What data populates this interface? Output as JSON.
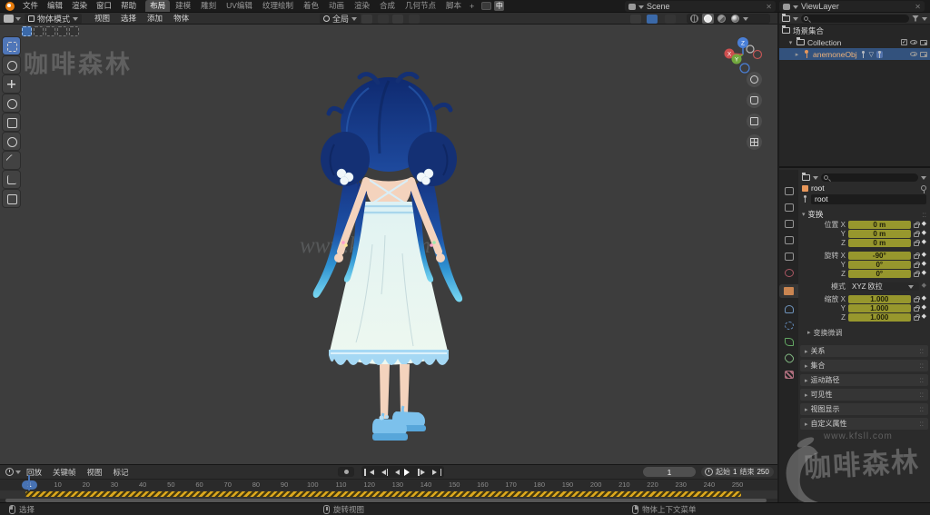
{
  "topbar": {
    "menus": [
      "文件",
      "编辑",
      "渲染",
      "窗口",
      "帮助"
    ],
    "workspaces": [
      {
        "label": "布局",
        "active": true
      },
      "建模",
      "雕刻",
      "UV编辑",
      "纹理绘制",
      "着色",
      "动画",
      "渲染",
      "合成",
      "几何节点",
      "脚本"
    ],
    "add_tab": "+",
    "ime_badge": "中",
    "scene_name": "Scene",
    "view_layer_name": "ViewLayer"
  },
  "viewport_header": {
    "mode": "物体模式",
    "menus": [
      "视图",
      "选择",
      "添加",
      "物体"
    ],
    "orientation": "全局"
  },
  "viewport": {
    "gizmo_axes": {
      "x": "X",
      "y": "Y",
      "z": "Z"
    },
    "watermark_brand": "咖啡森林",
    "watermark_url": "www.kfsll.com"
  },
  "outliner": {
    "scene_collection": "场景集合",
    "collection": "Collection",
    "object_name": "anemoneObj"
  },
  "properties": {
    "tabs": [
      "tool",
      "render",
      "output",
      "view-layer",
      "scene",
      "world",
      "object",
      "constraints",
      "physics",
      "object-data",
      "bone",
      "texture"
    ],
    "active_tab": "object",
    "breadcrumb_object": "root",
    "object_name": "root",
    "transform_title": "变换",
    "location_rows": [
      {
        "label": "位置 X",
        "value": "0 m"
      },
      {
        "label": "Y",
        "value": "0 m"
      },
      {
        "label": "Z",
        "value": "0 m"
      }
    ],
    "rotation_rows": [
      {
        "label": "旋转 X",
        "value": "-90°"
      },
      {
        "label": "Y",
        "value": "0°"
      },
      {
        "label": "Z",
        "value": "0°"
      }
    ],
    "mode_label": "模式",
    "mode_value": "XYZ 欧拉",
    "scale_rows": [
      {
        "label": "缩放 X",
        "value": "1.000"
      },
      {
        "label": "Y",
        "value": "1.000"
      },
      {
        "label": "Z",
        "value": "1.000"
      }
    ],
    "delta_transform": "变换微调",
    "sections": [
      "关系",
      "集合",
      "运动路径",
      "可见性",
      "视图显示",
      "自定义属性"
    ]
  },
  "timeline": {
    "menus": [
      "回放",
      "关键帧",
      "视图",
      "标记"
    ],
    "current_frame": "1",
    "start_label": "起始",
    "start_value": "1",
    "end_label": "结束",
    "end_value": "250",
    "ruler_ticks": [
      "10",
      "20",
      "30",
      "40",
      "50",
      "60",
      "70",
      "80",
      "90",
      "100",
      "110",
      "120",
      "130",
      "140",
      "150",
      "160",
      "170",
      "180",
      "190",
      "200",
      "210",
      "220",
      "230",
      "240",
      "250"
    ]
  },
  "statusbar": {
    "hints": [
      {
        "label": "选择"
      },
      {
        "label": "旋转视图"
      },
      {
        "label": "物体上下文菜单"
      }
    ]
  },
  "watermark": {
    "brand": "咖啡森林",
    "url": "www.kfsll.com"
  }
}
